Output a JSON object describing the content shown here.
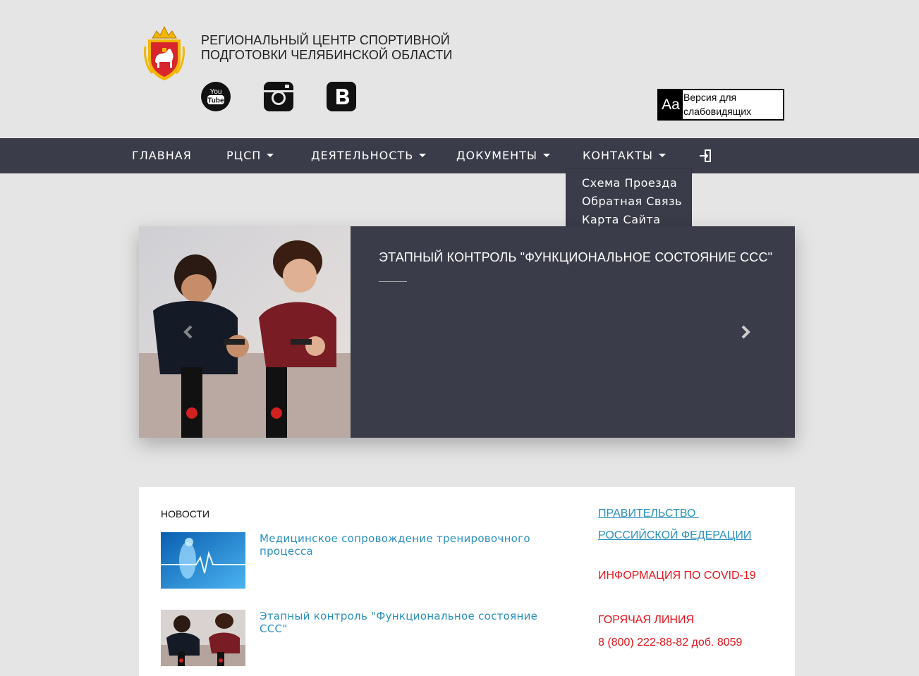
{
  "header": {
    "title_line1": "Региональный центр спортивной",
    "title_line2": "подготовки Челябинской области",
    "accessibility": {
      "icon_text": "Aa",
      "label": "Версия для слабовидящих"
    },
    "social": [
      "youtube-icon",
      "instagram-icon",
      "vk-icon"
    ]
  },
  "nav": {
    "items": [
      {
        "label": "Главная",
        "has_dropdown": false
      },
      {
        "label": "РЦСП",
        "has_dropdown": true
      },
      {
        "label": "Деятельность",
        "has_dropdown": true
      },
      {
        "label": "Документы",
        "has_dropdown": true
      },
      {
        "label": "Контакты",
        "has_dropdown": true
      }
    ],
    "login_icon": "login-icon",
    "contacts_dropdown": [
      "Схема Проезда",
      "Обратная Связь",
      "Карта Сайта"
    ]
  },
  "slider": {
    "title": "Этапный контроль \"Функциональное состояние ССС\""
  },
  "news": {
    "heading": "Новости",
    "items": [
      {
        "title": "Медицинское сопровождение тренировочного процесса"
      },
      {
        "title": "Этапный контроль \"Функциональное состояние ССС\""
      }
    ]
  },
  "sidebar": {
    "gov_link_line1": "Правительство ",
    "gov_link_line2": "Российской Федерации",
    "covid": "Информация по COVID-19",
    "hotline_label": "Горячая линия",
    "hotline_phone": "8 (800) 222-88-82 доб. 8059"
  },
  "colors": {
    "navbar": "#3a3d49",
    "link": "#2a8fbd",
    "alert": "#e2141b",
    "page_bg": "#e5e5e5"
  }
}
